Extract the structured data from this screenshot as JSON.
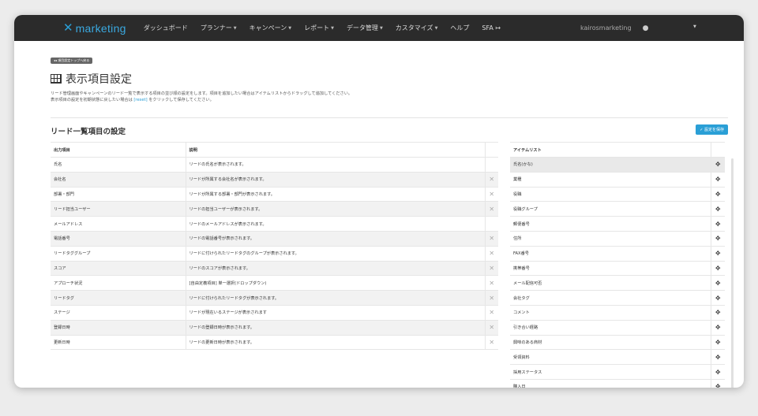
{
  "navbar": {
    "logo_icon": "✕",
    "logo_text": "marketing",
    "items": [
      {
        "label": "ダッシュボード",
        "caret": false
      },
      {
        "label": "プランナー",
        "caret": true
      },
      {
        "label": "キャンペーン",
        "caret": true
      },
      {
        "label": "レポート",
        "caret": true
      },
      {
        "label": "データ管理",
        "caret": true
      },
      {
        "label": "カスタマイズ",
        "caret": true
      },
      {
        "label": "ヘルプ",
        "caret": false
      },
      {
        "label": "SFA ↦",
        "caret": false
      }
    ],
    "username": "kairosmarketing"
  },
  "page": {
    "back_label": "◂◂ 項目設定トップへ戻る",
    "title": "表示項目設定",
    "desc_line1": "リード管理画面やキャンペーンのリード一覧で表示する項目の並び順の設定をします。項目を追加したい場合はアイテムリストからドラッグして追加してください。",
    "desc_line2_pre": "表示項目の設定を初期状態に戻したい場合は ",
    "desc_reset": "[reset]",
    "desc_line2_post": " をクリックして保存してください。",
    "section_title": "リード一覧項目の設定",
    "save_label": "✓ 設定を保存"
  },
  "lead_table": {
    "headers": [
      "出力項目",
      "説明"
    ],
    "rows": [
      {
        "name": "氏名",
        "desc": "リードの氏名が表示されます。",
        "removable": false
      },
      {
        "name": "会社名",
        "desc": "リードが所属する会社名が表示されます。",
        "removable": true
      },
      {
        "name": "部署・部門",
        "desc": "リードが所属する部署・部門が表示されます。",
        "removable": true
      },
      {
        "name": "リード担当ユーザー",
        "desc": "リードの担当ユーザーが表示されます。",
        "removable": true
      },
      {
        "name": "メールアドレス",
        "desc": "リードのメールアドレスが表示されます。",
        "removable": false
      },
      {
        "name": "電話番号",
        "desc": "リードの電話番号が表示されます。",
        "removable": true
      },
      {
        "name": "リードタググループ",
        "desc": "リードに付けられたリードタグのグループが表示されます。",
        "removable": true
      },
      {
        "name": "スコア",
        "desc": "リードのスコアが表示されます。",
        "removable": true
      },
      {
        "name": "アプローチ状況",
        "desc": "[自由定義項目] 単一選択(ドロップダウン)",
        "removable": true
      },
      {
        "name": "リードタグ",
        "desc": "リードに付けられたリードタグが表示されます。",
        "removable": true
      },
      {
        "name": "ステージ",
        "desc": "リードが現在いるステージが表示されます",
        "removable": true
      },
      {
        "name": "登録日時",
        "desc": "リードの登録日時が表示されます。",
        "removable": true
      },
      {
        "name": "更新日時",
        "desc": "リードの更新日時が表示されます。",
        "removable": true
      }
    ]
  },
  "item_list": {
    "header": "アイテムリスト",
    "items": [
      "氏名(かな)",
      "業種",
      "役職",
      "役職グループ",
      "郵便番号",
      "住所",
      "FAX番号",
      "携帯番号",
      "メール配信可否",
      "会社タグ",
      "コメント",
      "引き合い経路",
      "興味のある商材",
      "受領資料",
      "採用ステータス",
      "購入日"
    ]
  }
}
